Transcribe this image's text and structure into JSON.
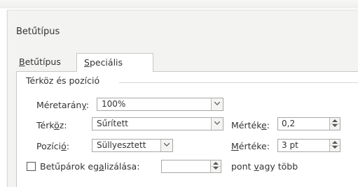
{
  "dialog": {
    "title": "Betűtípus",
    "tabs": [
      {
        "label_u": "B",
        "label_rest": "etűtípus",
        "active": false
      },
      {
        "label_u": "S",
        "label_rest": "peciális",
        "active": true
      }
    ]
  },
  "group": {
    "title": "Térköz és pozíció"
  },
  "scale": {
    "label_pre": "Méretarán",
    "label_u": "y",
    "label_post": ":",
    "value": "100%"
  },
  "spacing": {
    "label_pre": "Térk",
    "label_u": "ö",
    "label_post": "z:",
    "value": "Sűrített",
    "amount_label_pre": "Mérték",
    "amount_label_u": "e",
    "amount_label_post": ":",
    "amount_value": "0,2"
  },
  "position": {
    "label_pre": "Pozíci",
    "label_u": "ó",
    "label_post": ":",
    "value": "Süllyesztett",
    "amount_label_pre": "",
    "amount_label_u": "M",
    "amount_label_post": "értéke:",
    "amount_value": "3 pt"
  },
  "kerning": {
    "label_pre": "Betűpárok eg",
    "label_u": "a",
    "label_post": "lizálása:",
    "value": "",
    "suffix_pre": "pont ",
    "suffix_u": "v",
    "suffix_post": "agy több",
    "checked": false
  }
}
